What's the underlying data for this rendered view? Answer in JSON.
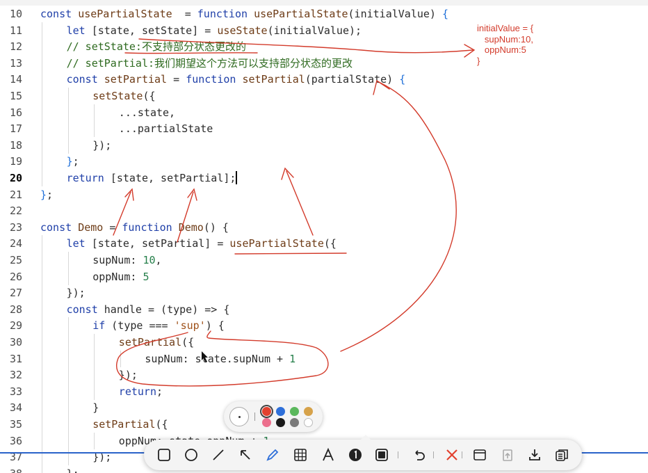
{
  "editor": {
    "active_line": "20",
    "lines": [
      {
        "num": "10",
        "indent": 0,
        "code": [
          [
            "kw",
            "const "
          ],
          [
            "fv",
            "usePartialState"
          ],
          [
            "",
            "  = "
          ],
          [
            "kw",
            "function "
          ],
          [
            "fn",
            "usePartialState"
          ],
          [
            "",
            "(initialValue) "
          ],
          [
            "br",
            "{"
          ]
        ]
      },
      {
        "num": "11",
        "indent": 1,
        "code": [
          [
            "kw",
            "let "
          ],
          [
            "",
            "[state, setState] = "
          ],
          [
            "fn",
            "useState"
          ],
          [
            "",
            "(initialValue);"
          ]
        ]
      },
      {
        "num": "12",
        "indent": 1,
        "code": [
          [
            "cm",
            "// setState:不支持部分状态更改的"
          ]
        ]
      },
      {
        "num": "13",
        "indent": 1,
        "code": [
          [
            "cm",
            "// setPartial:我们期望这个方法可以支持部分状态的更改"
          ]
        ]
      },
      {
        "num": "14",
        "indent": 1,
        "code": [
          [
            "kw",
            "const "
          ],
          [
            "fv",
            "setPartial"
          ],
          [
            "",
            " = "
          ],
          [
            "kw",
            "function "
          ],
          [
            "fn",
            "setPartial"
          ],
          [
            "",
            "(partialState) "
          ],
          [
            "br",
            "{"
          ]
        ]
      },
      {
        "num": "15",
        "indent": 2,
        "code": [
          [
            "fn",
            "setState"
          ],
          [
            "",
            "({"
          ]
        ]
      },
      {
        "num": "16",
        "indent": 3,
        "code": [
          [
            "",
            "...state,"
          ]
        ]
      },
      {
        "num": "17",
        "indent": 3,
        "code": [
          [
            "",
            "...partialState"
          ]
        ]
      },
      {
        "num": "18",
        "indent": 2,
        "code": [
          [
            "",
            "});"
          ]
        ]
      },
      {
        "num": "19",
        "indent": 1,
        "code": [
          [
            "br",
            "}"
          ],
          [
            "",
            ";"
          ]
        ]
      },
      {
        "num": "20",
        "indent": 1,
        "code": [
          [
            "kw",
            "return "
          ],
          [
            "",
            "[state, setPartial];"
          ]
        ],
        "cursor": true
      },
      {
        "num": "21",
        "indent": 0,
        "code": [
          [
            "br",
            "}"
          ],
          [
            "",
            ";"
          ]
        ]
      },
      {
        "num": "22",
        "indent": 0,
        "code": []
      },
      {
        "num": "23",
        "indent": 0,
        "code": [
          [
            "kw",
            "const "
          ],
          [
            "fv",
            "Demo"
          ],
          [
            "",
            " = "
          ],
          [
            "kw",
            "function "
          ],
          [
            "fn",
            "Demo"
          ],
          [
            "",
            "() {"
          ]
        ]
      },
      {
        "num": "24",
        "indent": 1,
        "code": [
          [
            "kw",
            "let "
          ],
          [
            "",
            "[state, setPartial] = "
          ],
          [
            "fn",
            "usePartialState"
          ],
          [
            "",
            "({"
          ]
        ]
      },
      {
        "num": "25",
        "indent": 2,
        "code": [
          [
            "",
            "supNum: "
          ],
          [
            "num",
            "10"
          ],
          [
            "",
            ","
          ]
        ]
      },
      {
        "num": "26",
        "indent": 2,
        "code": [
          [
            "",
            "oppNum: "
          ],
          [
            "num",
            "5"
          ]
        ]
      },
      {
        "num": "27",
        "indent": 1,
        "code": [
          [
            "",
            "});"
          ]
        ]
      },
      {
        "num": "28",
        "indent": 1,
        "code": [
          [
            "kw",
            "const "
          ],
          [
            "",
            "handle = (type) => {"
          ]
        ]
      },
      {
        "num": "29",
        "indent": 2,
        "code": [
          [
            "kw",
            "if "
          ],
          [
            "",
            "(type === "
          ],
          [
            "str",
            "'sup'"
          ],
          [
            "",
            ") {"
          ]
        ]
      },
      {
        "num": "30",
        "indent": 3,
        "code": [
          [
            "fn",
            "setPartial"
          ],
          [
            "",
            "({"
          ]
        ]
      },
      {
        "num": "31",
        "indent": 4,
        "code": [
          [
            "",
            "supNum: state.supNum + "
          ],
          [
            "num",
            "1"
          ]
        ]
      },
      {
        "num": "32",
        "indent": 3,
        "code": [
          [
            "",
            "});"
          ]
        ]
      },
      {
        "num": "33",
        "indent": 3,
        "code": [
          [
            "kw",
            "return"
          ],
          [
            "",
            ";"
          ]
        ]
      },
      {
        "num": "34",
        "indent": 2,
        "code": [
          [
            "",
            "}"
          ]
        ]
      },
      {
        "num": "35",
        "indent": 2,
        "code": [
          [
            "fn",
            "setPartial"
          ],
          [
            "",
            "({"
          ]
        ]
      },
      {
        "num": "36",
        "indent": 3,
        "code": [
          [
            "",
            "oppNum: state.oppNum + "
          ],
          [
            "num",
            "1"
          ]
        ]
      },
      {
        "num": "37",
        "indent": 2,
        "code": [
          [
            "",
            "});"
          ]
        ]
      },
      {
        "num": "38",
        "indent": 1,
        "code": [
          [
            "",
            "};"
          ]
        ]
      }
    ]
  },
  "annotation": {
    "note_lines": [
      "initialValue = {",
      "   supNum:10,",
      "   oppNum:5",
      "}"
    ],
    "ink_color": "#d33b2b"
  },
  "color_picker": {
    "swatches": [
      {
        "name": "red",
        "color": "#e2412f",
        "selected": true
      },
      {
        "name": "blue",
        "color": "#2e6fd9",
        "selected": false
      },
      {
        "name": "green",
        "color": "#5bb85d",
        "selected": false
      },
      {
        "name": "gold",
        "color": "#d6a24a",
        "selected": false
      },
      {
        "name": "pink",
        "color": "#ec6f8d",
        "selected": false
      },
      {
        "name": "black",
        "color": "#1a1a1a",
        "selected": false
      },
      {
        "name": "gray",
        "color": "#7a7a7a",
        "selected": false
      },
      {
        "name": "white",
        "color": "#ffffff",
        "selected": false
      }
    ]
  },
  "toolbar": {
    "tools": [
      "rectangle-icon",
      "ellipse-icon",
      "line-icon",
      "arrow-icon",
      "pen-icon",
      "mosaic-icon",
      "text-icon",
      "step-number-icon",
      "highlight-icon",
      "undo-icon",
      "close-icon",
      "pin-icon",
      "upload-icon",
      "download-icon",
      "copy-icon"
    ],
    "active_tool": "pen-icon"
  }
}
